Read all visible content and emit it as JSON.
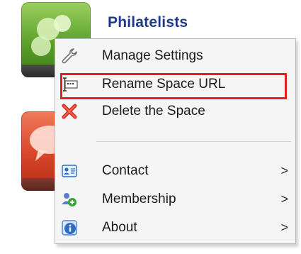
{
  "space": {
    "title": "Philatelists"
  },
  "menu": {
    "items": [
      {
        "label": "Manage Settings",
        "icon": "wrench-icon"
      },
      {
        "label": "Rename Space URL",
        "icon": "rename-url-icon",
        "highlighted": true
      },
      {
        "label": "Delete the Space",
        "icon": "delete-x-icon"
      }
    ],
    "submenus": [
      {
        "label": "Contact",
        "icon": "contact-card-icon",
        "chevron": ">"
      },
      {
        "label": "Membership",
        "icon": "membership-icon",
        "chevron": ">"
      },
      {
        "label": "About",
        "icon": "about-info-icon",
        "chevron": ">"
      }
    ]
  },
  "colors": {
    "title": "#1f3a8a",
    "highlight_border": "#e02020",
    "menu_background": "#f5f5f5"
  }
}
